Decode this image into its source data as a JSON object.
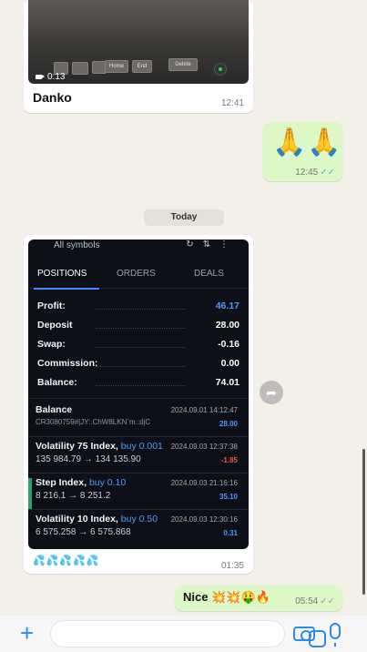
{
  "messages": {
    "video": {
      "duration": "0:13",
      "caption": "Danko",
      "time": "12:41",
      "keys": [
        "Home",
        "End",
        "Delete"
      ]
    },
    "emoji": {
      "content": "🙏🙏",
      "time": "12:45"
    },
    "date_chip": "Today",
    "screenshot": {
      "time": "01:35",
      "caption": "💦💦💦💦💦",
      "trade_app": {
        "header": "All symbols",
        "tabs": [
          "POSITIONS",
          "ORDERS",
          "DEALS"
        ],
        "active_tab": "POSITIONS",
        "summary": [
          {
            "label": "Profit:",
            "value": "46.17"
          },
          {
            "label": "Deposit",
            "value": "28.00"
          },
          {
            "label": "Swap:",
            "value": "-0.16"
          },
          {
            "label": "Commission:",
            "value": "0.00"
          },
          {
            "label": "Balance:",
            "value": "74.01"
          }
        ],
        "deals": [
          {
            "name": "Balance",
            "volume": "",
            "date": "2024.09.01 14:12:47",
            "detail": "CR3080759#|JY:.ChW8LKN`m.:djC",
            "amount": "28.00",
            "amount_color": "blue"
          },
          {
            "name": "Volatility 75 Index,",
            "volume": "buy 0.001",
            "date": "2024.09.03 12:37:38",
            "detail": "135 984.79 → 134 135.90",
            "amount": "-1.85",
            "amount_color": "red"
          },
          {
            "name": "Step Index,",
            "volume": "buy 0.10",
            "date": "2024.09.03 21:16:16",
            "detail": "8 216.1 → 8 251.2",
            "amount": "35.10",
            "amount_color": "blue"
          },
          {
            "name": "Volatility 10 Index,",
            "volume": "buy 0.50",
            "date": "2024.09.03 12:30:16",
            "detail": "6 575.258 → 6 575.868",
            "amount": "0.31",
            "amount_color": "blue"
          }
        ]
      }
    },
    "nice": {
      "text": "Nice 💥💥🤑🔥",
      "time": "05:54"
    }
  },
  "input_bar": {
    "placeholder": ""
  },
  "colors": {
    "outgoing_bubble": "#dcf8c6",
    "incoming_bubble": "#ffffff",
    "accent": "#2b8be8",
    "read_ticks": "#4fb5e6"
  }
}
